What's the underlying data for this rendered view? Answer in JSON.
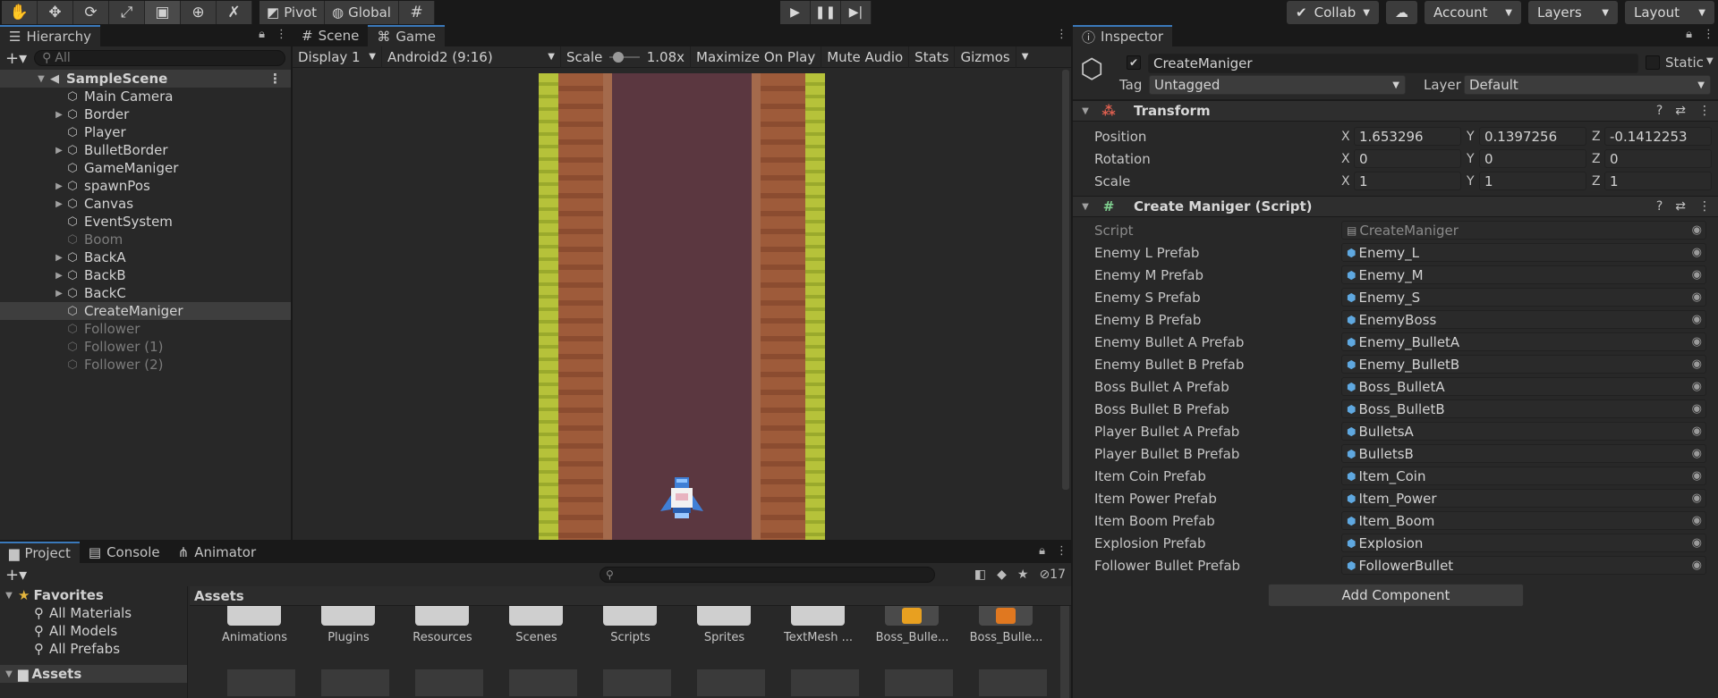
{
  "toolbar": {
    "tools": [
      "hand-icon",
      "move-icon",
      "rotate-icon",
      "scale-icon",
      "rect-icon",
      "transform-icon",
      "custom-tool-icon"
    ],
    "pivot_label": "Pivot",
    "global_label": "Global",
    "collab_label": "Collab",
    "account_label": "Account",
    "layers_label": "Layers",
    "layout_label": "Layout"
  },
  "hierarchy": {
    "tab_label": "Hierarchy",
    "search_placeholder": "All",
    "scene_name": "SampleScene",
    "items": [
      {
        "label": "Main Camera",
        "foldable": false,
        "enabled": true
      },
      {
        "label": "Border",
        "foldable": true,
        "enabled": true
      },
      {
        "label": "Player",
        "foldable": false,
        "enabled": true
      },
      {
        "label": "BulletBorder",
        "foldable": true,
        "enabled": true
      },
      {
        "label": "GameManiger",
        "foldable": false,
        "enabled": true
      },
      {
        "label": "spawnPos",
        "foldable": true,
        "enabled": true
      },
      {
        "label": "Canvas",
        "foldable": true,
        "enabled": true
      },
      {
        "label": "EventSystem",
        "foldable": false,
        "enabled": true
      },
      {
        "label": "Boom",
        "foldable": false,
        "enabled": false
      },
      {
        "label": "BackA",
        "foldable": true,
        "enabled": true
      },
      {
        "label": "BackB",
        "foldable": true,
        "enabled": true
      },
      {
        "label": "BackC",
        "foldable": true,
        "enabled": true
      },
      {
        "label": "CreateManiger",
        "foldable": false,
        "enabled": true,
        "selected": true
      },
      {
        "label": "Follower",
        "foldable": false,
        "enabled": false
      },
      {
        "label": "Follower (1)",
        "foldable": false,
        "enabled": false
      },
      {
        "label": "Follower (2)",
        "foldable": false,
        "enabled": false
      }
    ]
  },
  "game": {
    "tab_scene": "Scene",
    "tab_game": "Game",
    "display": "Display 1",
    "resolution": "Android2 (9:16)",
    "scale_label": "Scale",
    "scale_value": "1.08x",
    "maximize": "Maximize On Play",
    "mute": "Mute Audio",
    "stats": "Stats",
    "gizmos": "Gizmos"
  },
  "inspector": {
    "tab_label": "Inspector",
    "object_name": "CreateManiger",
    "static_label": "Static",
    "tag_label": "Tag",
    "tag_value": "Untagged",
    "layer_label": "Layer",
    "layer_value": "Default",
    "transform": {
      "title": "Transform",
      "position_label": "Position",
      "rotation_label": "Rotation",
      "scale_label": "Scale",
      "position": {
        "x": "1.653296",
        "y": "0.1397256",
        "z": "-0.1412253"
      },
      "rotation": {
        "x": "0",
        "y": "0",
        "z": "0"
      },
      "scale": {
        "x": "1",
        "y": "1",
        "z": "1"
      }
    },
    "script_component": {
      "title": "Create Maniger (Script)",
      "script_label": "Script",
      "script_value": "CreateManiger",
      "props": [
        {
          "label": "Enemy L Prefab",
          "value": "Enemy_L"
        },
        {
          "label": "Enemy M Prefab",
          "value": "Enemy_M"
        },
        {
          "label": "Enemy S Prefab",
          "value": "Enemy_S"
        },
        {
          "label": "Enemy B Prefab",
          "value": "EnemyBoss"
        },
        {
          "label": "Enemy Bullet A Prefab",
          "value": "Enemy_BulletA"
        },
        {
          "label": "Enemy Bullet B Prefab",
          "value": "Enemy_BulletB"
        },
        {
          "label": "Boss Bullet A Prefab",
          "value": "Boss_BulletA"
        },
        {
          "label": "Boss Bullet B Prefab",
          "value": "Boss_BulletB"
        },
        {
          "label": "Player Bullet A Prefab",
          "value": "BulletsA"
        },
        {
          "label": "Player Bullet B Prefab",
          "value": "BulletsB"
        },
        {
          "label": "Item Coin Prefab",
          "value": "Item_Coin"
        },
        {
          "label": "Item Power Prefab",
          "value": "Item_Power"
        },
        {
          "label": "Item Boom Prefab",
          "value": "Item_Boom"
        },
        {
          "label": "Explosion Prefab",
          "value": "Explosion"
        },
        {
          "label": "Follower Bullet Prefab",
          "value": "FollowerBullet"
        }
      ]
    },
    "add_component": "Add Component"
  },
  "project": {
    "tab_project": "Project",
    "tab_console": "Console",
    "tab_animator": "Animator",
    "hidden_count": "17",
    "favorites_label": "Favorites",
    "favorites": [
      "All Materials",
      "All Models",
      "All Prefabs"
    ],
    "assets_root": "Assets",
    "assets_title": "Assets",
    "folders": [
      {
        "label": "Animations",
        "kind": "folder"
      },
      {
        "label": "Plugins",
        "kind": "folder"
      },
      {
        "label": "Resources",
        "kind": "folder"
      },
      {
        "label": "Scenes",
        "kind": "folder"
      },
      {
        "label": "Scripts",
        "kind": "folder"
      },
      {
        "label": "Sprites",
        "kind": "folder"
      },
      {
        "label": "TextMesh ...",
        "kind": "folder"
      },
      {
        "label": "Boss_Bulle...",
        "kind": "sprite"
      },
      {
        "label": "Boss_Bulle...",
        "kind": "sprite"
      }
    ]
  },
  "colors": {
    "accent": "#3a79bb",
    "panel_bg": "#282828",
    "level_bg": "#5b3740",
    "grass": "#b6c23a"
  }
}
